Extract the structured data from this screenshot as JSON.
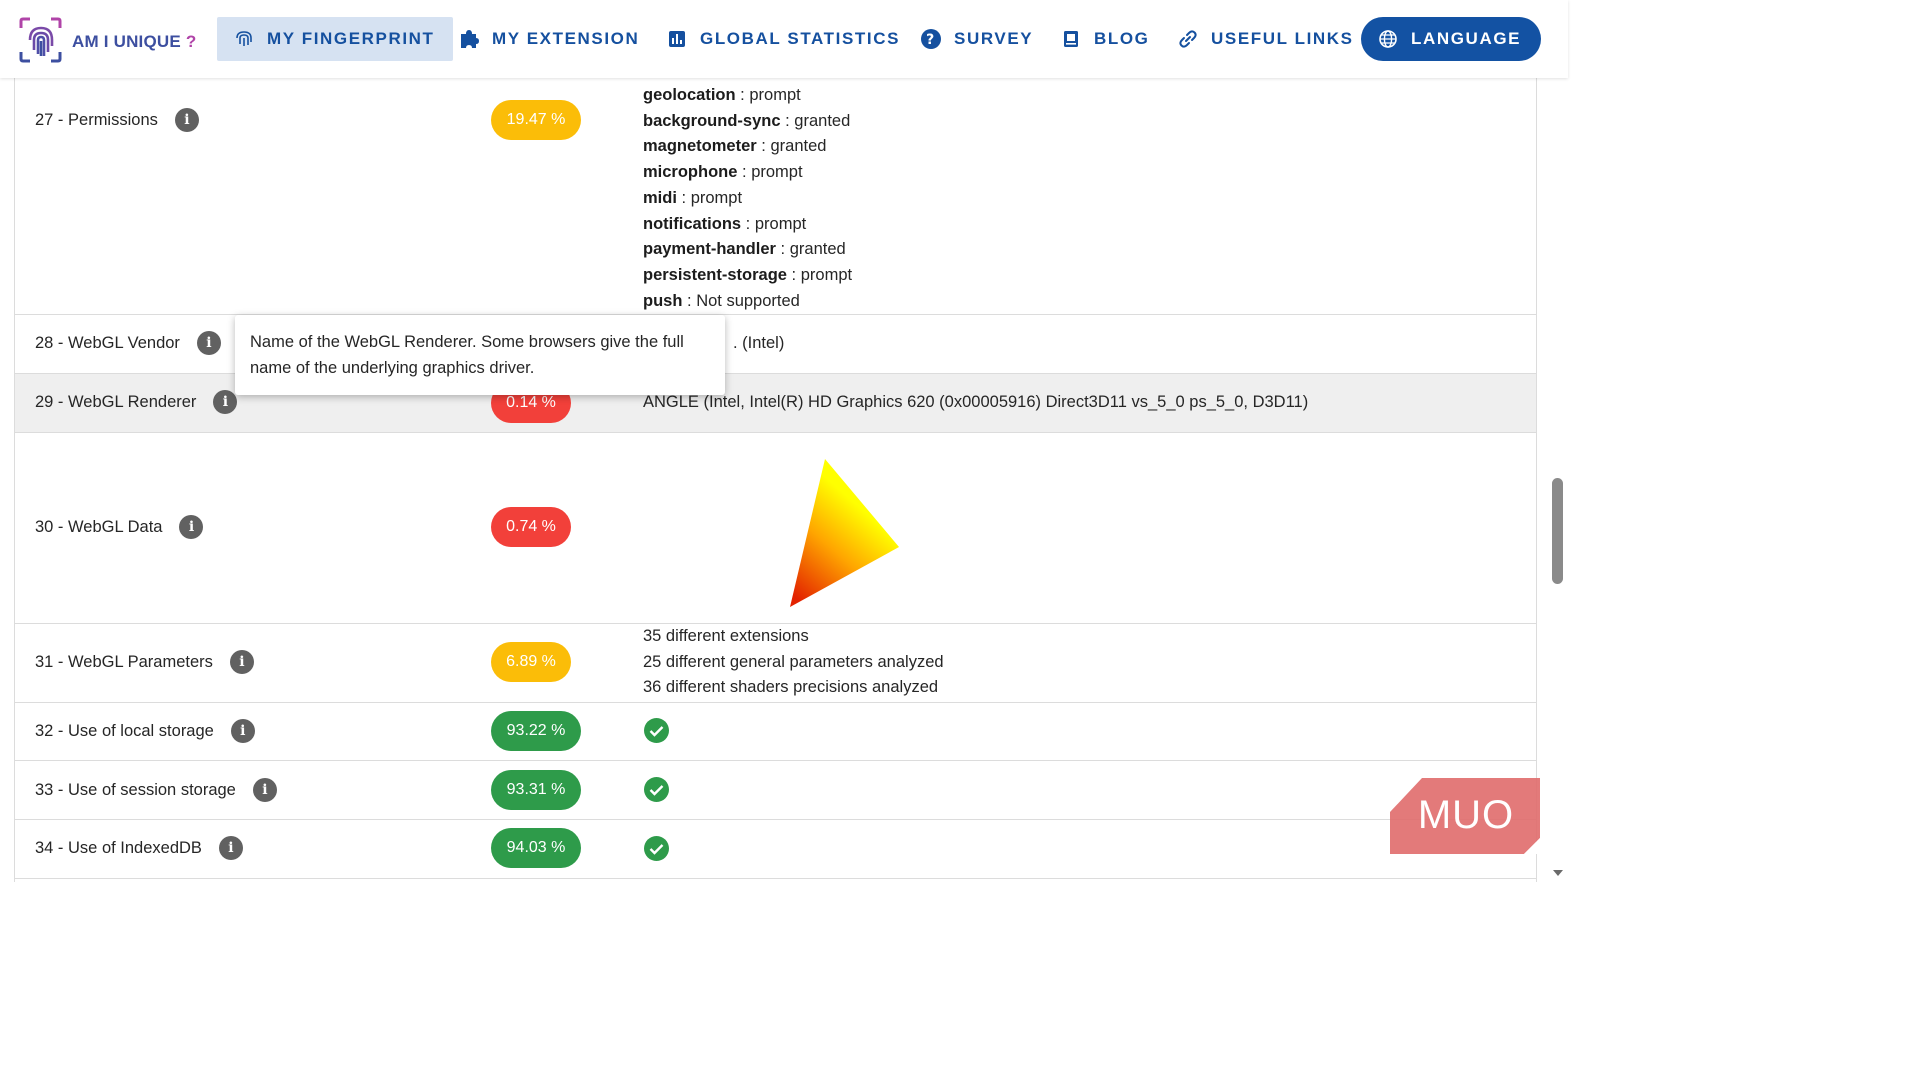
{
  "nav": {
    "logo_text": "AM I UNIQUE",
    "logo_q": "?",
    "items": [
      {
        "label": "MY FINGERPRINT",
        "icon": "fingerprint-icon",
        "active": true
      },
      {
        "label": "MY EXTENSION",
        "icon": "puzzle-icon"
      },
      {
        "label": "GLOBAL STATISTICS",
        "icon": "bar-chart-icon"
      },
      {
        "label": "SURVEY",
        "icon": "help-circle-icon"
      },
      {
        "label": "BLOG",
        "icon": "book-icon"
      },
      {
        "label": "USEFUL LINKS",
        "icon": "link-icon"
      },
      {
        "label": "LANGUAGE",
        "icon": "globe-icon"
      }
    ]
  },
  "rows": {
    "permissions": {
      "label": "27 - Permissions",
      "badge": "19.47 %",
      "badge_color": "#fbbd08",
      "items": [
        {
          "key": "geolocation",
          "sep": " : ",
          "value": "prompt"
        },
        {
          "key": "background-sync",
          "sep": " : ",
          "value": "granted"
        },
        {
          "key": "magnetometer",
          "sep": " : ",
          "value": "granted"
        },
        {
          "key": "microphone",
          "sep": " : ",
          "value": "prompt"
        },
        {
          "key": "midi",
          "sep": " : ",
          "value": "prompt"
        },
        {
          "key": "notifications",
          "sep": " : ",
          "value": "prompt"
        },
        {
          "key": "payment-handler",
          "sep": " : ",
          "value": "granted"
        },
        {
          "key": "persistent-storage",
          "sep": " : ",
          "value": "prompt"
        },
        {
          "key": "push",
          "sep": " : ",
          "value": "Not supported"
        }
      ]
    },
    "webgl_vendor": {
      "label": "28 - WebGL Vendor",
      "value_visible": ". (Intel)"
    },
    "webgl_renderer": {
      "label": "29 - WebGL Renderer",
      "badge": "0.14 %",
      "badge_color": "#f2403a",
      "value": "ANGLE (Intel, Intel(R) HD Graphics 620 (0x00005916) Direct3D11 vs_5_0 ps_5_0, D3D11)"
    },
    "webgl_data": {
      "label": "30 - WebGL Data",
      "badge": "0.74 %",
      "badge_color": "#f2403a"
    },
    "webgl_params": {
      "label": "31 - WebGL Parameters",
      "badge": "6.89 %",
      "badge_color": "#fbbd08",
      "lines": [
        "35 different extensions",
        "25 different general parameters analyzed",
        "36 different shaders precisions analyzed"
      ]
    },
    "local_storage": {
      "label": "32 - Use of local storage",
      "badge": "93.22 %",
      "badge_color": "#2e9b4a"
    },
    "session_storage": {
      "label": "33 - Use of session storage",
      "badge": "93.31 %",
      "badge_color": "#2e9b4a"
    },
    "indexeddb": {
      "label": "34 - Use of IndexedDB",
      "badge": "94.03 %",
      "badge_color": "#2e9b4a"
    }
  },
  "tooltip": {
    "text": "Name of the WebGL Renderer. Some browsers give the full name of the underlying graphics driver."
  },
  "watermark": {
    "text": "MUO"
  }
}
